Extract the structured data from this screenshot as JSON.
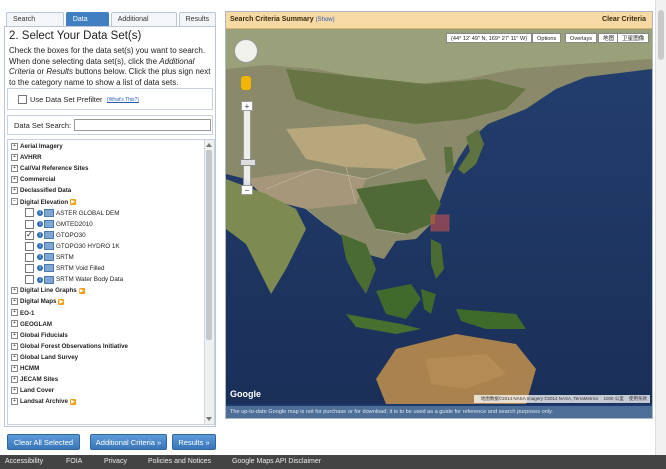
{
  "tabs": [
    "Search Criteria",
    "Data Sets",
    "Additional Criteria",
    "Results"
  ],
  "active_tab": "Data Sets",
  "step_title": "2. Select Your Data Set(s)",
  "instructions": {
    "part1": "Check the boxes for the data set(s) you want to search. When done selecting data set(s), click the ",
    "italic1": "Additional Criteria",
    "part2": " or ",
    "italic2": "Results",
    "part3": " buttons below. Click the plus sign next to the category name to show a list of data sets."
  },
  "prefilter": {
    "label": "Use Data Set Prefilter",
    "help_link": "(What's This?)",
    "checked": false
  },
  "dataset_search": {
    "label": "Data Set Search:",
    "value": ""
  },
  "categories": [
    {
      "label": "Aerial Imagery",
      "badge": false
    },
    {
      "label": "AVHRR",
      "badge": false
    },
    {
      "label": "Cal/Val Reference Sites",
      "badge": false
    },
    {
      "label": "Commercial",
      "badge": false
    },
    {
      "label": "Declassified Data",
      "badge": false
    },
    {
      "label": "Digital Elevation",
      "badge": true
    }
  ],
  "elevation_datasets": [
    {
      "label": "ASTER GLOBAL DEM",
      "checked": false
    },
    {
      "label": "GMTED2010",
      "checked": false
    },
    {
      "label": "GTOPO30",
      "checked": true
    },
    {
      "label": "GTOPO30 HYDRO 1K",
      "checked": false
    },
    {
      "label": "SRTM",
      "checked": false
    },
    {
      "label": "SRTM Void Filled",
      "checked": false
    },
    {
      "label": "SRTM Water Body Data",
      "checked": false
    }
  ],
  "categories_after": [
    {
      "label": "Digital Line Graphs",
      "badge": true
    },
    {
      "label": "Digital Maps",
      "badge": true
    },
    {
      "label": "EO-1",
      "badge": false
    },
    {
      "label": "GEOGLAM",
      "badge": false
    },
    {
      "label": "Global Fiducials",
      "badge": false
    },
    {
      "label": "Global Forest Observations Initiative",
      "badge": false
    },
    {
      "label": "Global Land Survey",
      "badge": false
    },
    {
      "label": "HCMM",
      "badge": false
    },
    {
      "label": "JECAM Sites",
      "badge": false
    },
    {
      "label": "Land Cover",
      "badge": false
    },
    {
      "label": "Landsat Archive",
      "badge": true
    }
  ],
  "buttons": {
    "clear": "Clear All Selected",
    "additional": "Additional Criteria »",
    "results": "Results »"
  },
  "map": {
    "header_title": "Search Criteria Summary",
    "header_show": "(Show)",
    "clear_criteria": "Clear Criteria",
    "coords": "(44° 12' 49\" N, 169° 27' 11\" W)",
    "options": "Options",
    "overlays": "Overlays",
    "map_btn": "地图",
    "satellite_btn": "卫星图像",
    "google": "Google",
    "attribution": "地图数据©2014 NASA Imagery ©2014 NASA, TerraMetrics",
    "scale": "1000 公里",
    "terms": "使用条款",
    "footer_note": "The up-to-date Google map is not for purchase or for download; it is to be used as a guide for reference and search purposes only."
  },
  "footer_links": [
    "Accessibility",
    "FOIA",
    "Privacy",
    "Policies and Notices",
    "Google Maps API Disclaimer"
  ],
  "colors": {
    "accent": "#3f7fc2",
    "map_header": "#f6d9a4",
    "selection": "#d9534f"
  }
}
